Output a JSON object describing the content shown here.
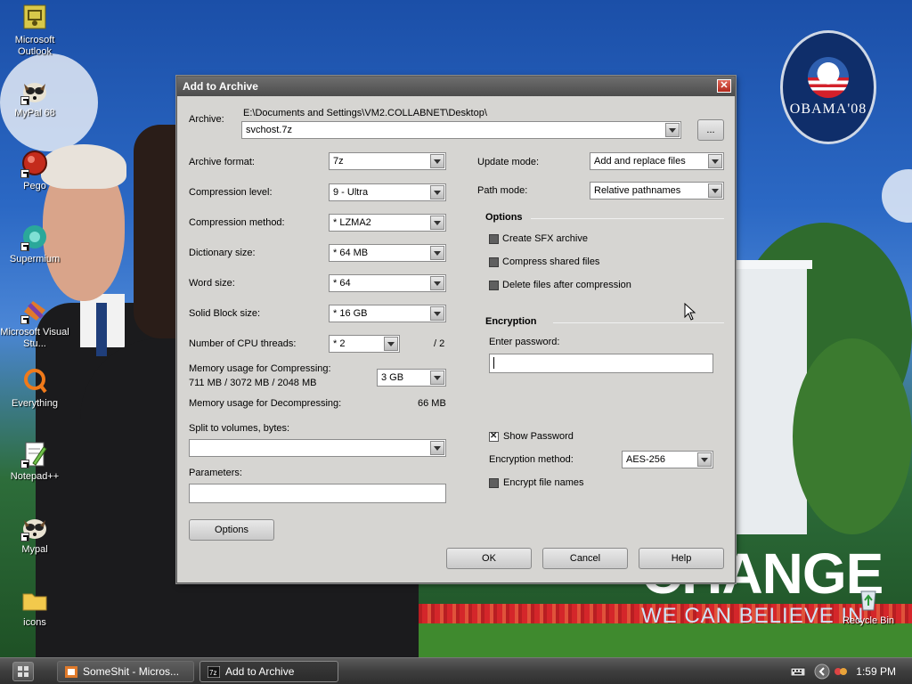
{
  "desktop": {
    "icons": [
      {
        "label": "Microsoft Outlook",
        "icon": "outlook-icon"
      },
      {
        "label": "MyPal 68",
        "icon": "mypal-icon"
      },
      {
        "label": "Pego",
        "icon": "pego-icon"
      },
      {
        "label": "Supermium",
        "icon": "supermium-icon"
      },
      {
        "label": "Microsoft Visual Stu...",
        "icon": "visual-studio-icon"
      },
      {
        "label": "Everything",
        "icon": "everything-icon"
      },
      {
        "label": "Notepad++",
        "icon": "notepad-plus-plus-icon"
      },
      {
        "label": "Mypal",
        "icon": "mypal-icon"
      },
      {
        "label": "icons",
        "icon": "folder-icon"
      }
    ],
    "recycle_bin": "Recycle Bin",
    "wallpaper": {
      "badge_text": "OBAMA'08",
      "slogan_main": "CHANGE",
      "slogan_sub": "WE CAN BELIEVE IN"
    }
  },
  "dialog": {
    "title": "Add to Archive",
    "archive_label": "Archive:",
    "archive_path": "E:\\Documents and Settings\\VM2.COLLABNET\\Desktop\\",
    "archive_name": "svchost.7z",
    "browse_label": "...",
    "archive_format_label": "Archive format:",
    "archive_format": "7z",
    "compression_level_label": "Compression level:",
    "compression_level": "9 - Ultra",
    "compression_method_label": "Compression method:",
    "compression_method": "* LZMA2",
    "dictionary_size_label": "Dictionary size:",
    "dictionary_size": "* 64 MB",
    "word_size_label": "Word size:",
    "word_size": "* 64",
    "solid_block_label": "Solid Block size:",
    "solid_block": "* 16 GB",
    "cpu_threads_label": "Number of CPU threads:",
    "cpu_threads": "* 2",
    "cpu_threads_total": "/ 2",
    "mem_compress_label": "Memory usage for Compressing:",
    "mem_compress_detail": "711 MB / 3072 MB / 2048 MB",
    "mem_compress_value": "3 GB",
    "mem_decompress_label": "Memory usage for Decompressing:",
    "mem_decompress_value": "66 MB",
    "split_label": "Split to volumes, bytes:",
    "split_value": "",
    "parameters_label": "Parameters:",
    "parameters_value": "",
    "options_button": "Options",
    "update_mode_label": "Update mode:",
    "update_mode": "Add and replace files",
    "path_mode_label": "Path mode:",
    "path_mode": "Relative pathnames",
    "options_group": "Options",
    "create_sfx": "Create SFX archive",
    "compress_shared": "Compress shared files",
    "delete_after": "Delete files after compression",
    "encryption_group": "Encryption",
    "enter_password_label": "Enter password:",
    "password_value": "",
    "show_password": "Show Password",
    "encryption_method_label": "Encryption method:",
    "encryption_method": "AES-256",
    "encrypt_names": "Encrypt file names",
    "ok_button": "OK",
    "cancel_button": "Cancel",
    "help_button": "Help"
  },
  "taskbar": {
    "tasks": [
      {
        "label": "SomeShit - Micros...",
        "active": false
      },
      {
        "label": "Add to Archive",
        "active": true
      }
    ],
    "clock": "1:59 PM"
  }
}
